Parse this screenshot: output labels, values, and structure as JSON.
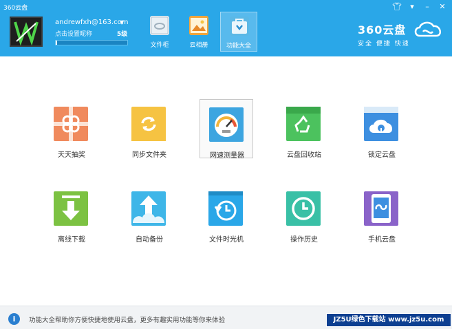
{
  "app": {
    "title": "360云盘"
  },
  "window": {
    "skin_icon": "shirt-icon",
    "menu_icon": "menu-icon",
    "minimize_icon": "minimize-icon",
    "close_icon": "close-icon"
  },
  "user": {
    "email": "andrewfxh@163.com",
    "set_nickname": "点击设置昵称",
    "level": "5级",
    "quota_used_fraction": 0.02
  },
  "nav_tabs": [
    {
      "label": "文件柜",
      "icon": "file-cabinet-icon"
    },
    {
      "label": "云相册",
      "icon": "photo-album-icon"
    },
    {
      "label": "功能大全",
      "icon": "toolbox-icon",
      "active": true
    }
  ],
  "brand": {
    "name": "360云盘",
    "slogan": "安全 便捷 快速"
  },
  "features": [
    {
      "label": "天天抽奖",
      "icon": "gift-icon",
      "color": "#f08a5d"
    },
    {
      "label": "同步文件夹",
      "icon": "sync-folder-icon",
      "color": "#f6c342"
    },
    {
      "label": "网速测量器",
      "icon": "speedometer-icon",
      "color": "#3da5e0",
      "selected": true
    },
    {
      "label": "云盘回收站",
      "icon": "recycle-bin-icon",
      "color": "#4cc25e"
    },
    {
      "label": "锁定云盘",
      "icon": "lock-cloud-icon",
      "color": "#3d8fe0"
    },
    {
      "label": "离线下载",
      "icon": "download-icon",
      "color": "#7cc242"
    },
    {
      "label": "自动备份",
      "icon": "backup-icon",
      "color": "#3eb6e8"
    },
    {
      "label": "文件时光机",
      "icon": "time-machine-icon",
      "color": "#2aa7e8"
    },
    {
      "label": "操作历史",
      "icon": "clock-icon",
      "color": "#39c0a6"
    },
    {
      "label": "手机云盘",
      "icon": "phone-cloud-icon",
      "color": "#8a63c9"
    }
  ],
  "footer": {
    "info_icon": "info-icon",
    "text": "功能大全帮助你方便快捷地使用云盘，更多有趣实用功能等你来体验"
  },
  "watermark": "JZ5U绿色下载站 www.jz5u.com"
}
